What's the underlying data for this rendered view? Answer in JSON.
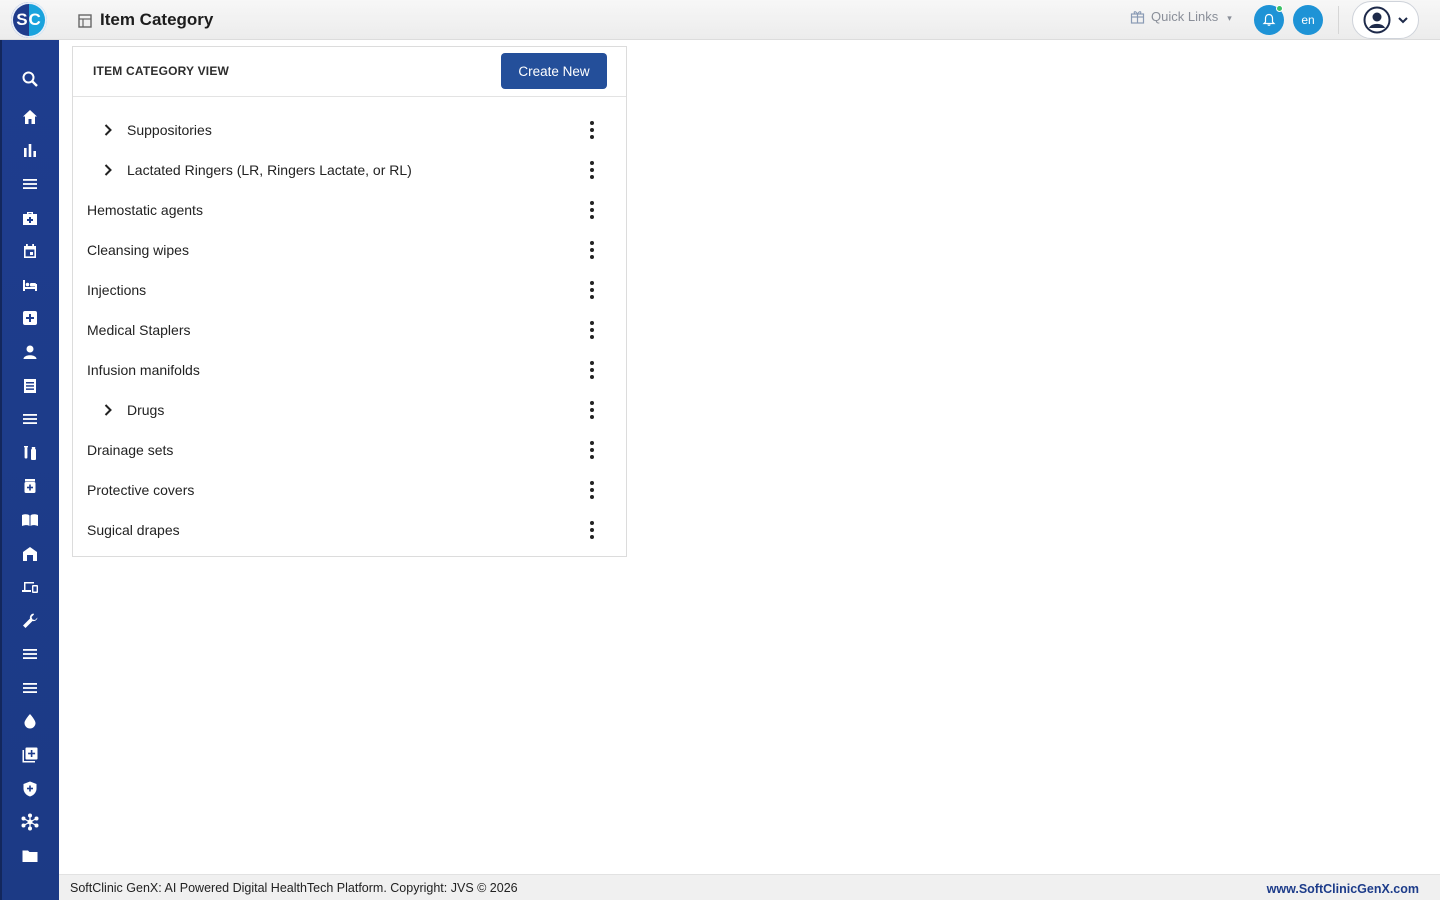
{
  "app": {
    "logo_text": "SC"
  },
  "header": {
    "title": "Item Category",
    "quick_links_label": "Quick Links",
    "language": "en"
  },
  "colors": {
    "brand_dark": "#1e3d8e",
    "brand_light": "#1e93d6",
    "button": "#244f9a"
  },
  "sidebar": {
    "icons": [
      "search-icon",
      "home-icon",
      "bar-chart-icon",
      "menu-icon",
      "medical-bag-icon",
      "calendar-icon",
      "bed-icon",
      "medical-cross-icon",
      "person-icon",
      "receipt-icon",
      "list-icon",
      "lab-icon",
      "pharmacy-icon",
      "book-icon",
      "store-icon",
      "devices-icon",
      "wrench-icon",
      "lines-icon",
      "lines2-icon",
      "drop-icon",
      "add-library-icon",
      "shield-icon",
      "network-icon",
      "folder-icon"
    ]
  },
  "card": {
    "title": "ITEM CATEGORY VIEW",
    "create_label": "Create New",
    "items": [
      {
        "label": "Suppositories",
        "expandable": true
      },
      {
        "label": "Lactated Ringers (LR, Ringers Lactate, or RL)",
        "expandable": true
      },
      {
        "label": "Hemostatic agents",
        "expandable": false
      },
      {
        "label": "Cleansing wipes",
        "expandable": false
      },
      {
        "label": "Injections",
        "expandable": false
      },
      {
        "label": "Medical Staplers",
        "expandable": false
      },
      {
        "label": "Infusion manifolds",
        "expandable": false
      },
      {
        "label": "Drugs",
        "expandable": true
      },
      {
        "label": "Drainage sets",
        "expandable": false
      },
      {
        "label": "Protective covers",
        "expandable": false
      },
      {
        "label": "Sugical drapes",
        "expandable": false
      }
    ]
  },
  "footer": {
    "left": "SoftClinic GenX: AI Powered Digital HealthTech Platform. Copyright: JVS © 2026",
    "right": "www.SoftClinicGenX.com"
  }
}
